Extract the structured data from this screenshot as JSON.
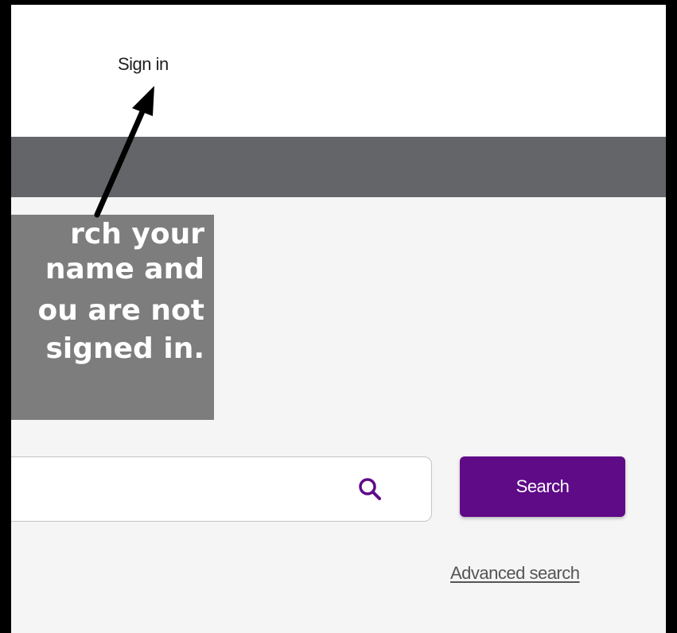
{
  "header": {
    "sign_in_label": "Sign in"
  },
  "search": {
    "input_value": "",
    "button_label": "Search",
    "advanced_label": "Advanced search"
  },
  "callout": {
    "lines": [
      "rch your",
      "name and",
      "ou are not",
      "signed in."
    ]
  },
  "colors": {
    "accent": "#5f0a87",
    "nav_band": "#636569",
    "callout_bg": "#7d7d7d"
  },
  "icons": {
    "search": "magnifier-icon",
    "pointer": "arrow-icon"
  }
}
